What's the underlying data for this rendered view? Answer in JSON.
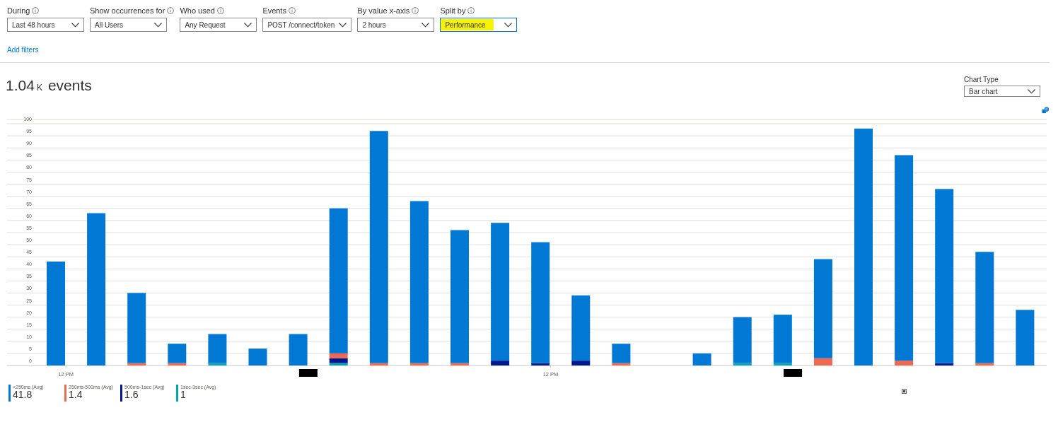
{
  "filters": [
    {
      "label": "During",
      "value": "Last 48 hours",
      "highlighted": false
    },
    {
      "label": "Show occurrences for",
      "value": "All Users",
      "highlighted": false
    },
    {
      "label": "Who used",
      "value": "Any Request",
      "highlighted": false
    },
    {
      "label": "Events",
      "value": "POST /connect/token",
      "highlighted": false
    },
    {
      "label": "By value x-axis",
      "value": "2 hours",
      "highlighted": false
    },
    {
      "label": "Split by",
      "value": "Performance",
      "highlighted": true
    }
  ],
  "add_filters": "Add filters",
  "summary": {
    "value": "1.04",
    "unit": "K",
    "label": "events"
  },
  "chart_type": {
    "label": "Chart Type",
    "value": "Bar chart"
  },
  "chart": {
    "chart_data": {
      "type": "bar",
      "stacked": true,
      "categories": [
        "12 PM",
        null,
        null,
        null,
        null,
        null,
        null,
        null,
        null,
        null,
        null,
        null,
        "12 PM",
        null,
        null,
        null,
        null,
        null,
        null,
        null,
        null,
        null,
        null,
        null,
        null
      ],
      "series": [
        {
          "name": "<250ms (Avg)",
          "color": "#0078d4",
          "values": [
            43,
            63,
            29,
            8,
            12,
            7,
            13,
            60,
            96,
            67,
            55,
            57,
            50,
            27,
            8,
            0,
            5,
            19,
            20,
            41,
            98,
            85,
            72,
            46,
            23
          ]
        },
        {
          "name": "250ms-500ms (Avg)",
          "color": "#ef6950",
          "values": [
            0,
            0,
            1,
            1,
            0,
            0,
            0,
            2,
            1,
            1,
            1,
            0,
            0,
            0,
            1,
            0,
            0,
            0,
            0,
            3,
            0,
            2,
            0,
            1,
            0
          ]
        },
        {
          "name": "500ms-1sec (Avg)",
          "color": "#00188f",
          "values": [
            0,
            0,
            0,
            0,
            0,
            0,
            0,
            2,
            0,
            0,
            0,
            2,
            1,
            2,
            0,
            0,
            0,
            0,
            0,
            0,
            0,
            0,
            1,
            0,
            0
          ]
        },
        {
          "name": "1sec-3sec (Avg)",
          "color": "#00a5b0",
          "values": [
            0,
            0,
            0,
            0,
            1,
            0,
            0,
            1,
            0,
            0,
            0,
            0,
            0,
            0,
            0,
            0,
            0,
            1,
            1,
            0,
            0,
            0,
            0,
            0,
            0
          ]
        }
      ],
      "ylim": [
        0,
        100
      ],
      "grid": true,
      "yticks": [
        0,
        5,
        10,
        15,
        20,
        25,
        30,
        35,
        40,
        45,
        50,
        55,
        60,
        65,
        70,
        75,
        80,
        85,
        90,
        95,
        100
      ]
    },
    "legend_values": [
      "41.8",
      "1.4",
      "1.6",
      "1"
    ]
  }
}
